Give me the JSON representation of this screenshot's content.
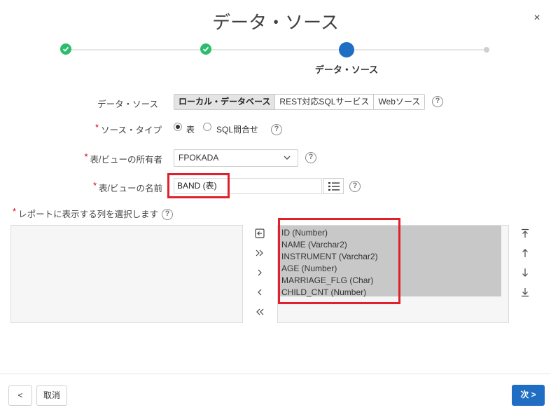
{
  "dialog": {
    "title": "データ・ソース",
    "close": "×"
  },
  "wizard": {
    "current_label": "データ・ソース"
  },
  "form": {
    "data_source_label": "データ・ソース",
    "data_source_options": [
      "ローカル・データベース",
      "REST対応SQLサービス",
      "Webソース"
    ],
    "source_type_label": "ソース・タイプ",
    "source_type_options": [
      "表",
      "SQL問合せ"
    ],
    "owner_label": "表/ビューの所有者",
    "owner_value": "FPOKADA",
    "name_label": "表/ビューの名前",
    "name_value": "BAND (表)",
    "columns_label": "レポートに表示する列を選択します",
    "help": "?",
    "required_mark": "*"
  },
  "shuttle": {
    "selected_columns": [
      "ID (Number)",
      "NAME (Varchar2)",
      "INSTRUMENT (Varchar2)",
      "AGE (Number)",
      "MARRIAGE_FLG (Char)",
      "CHILD_CNT (Number)"
    ]
  },
  "footer": {
    "back": "<",
    "cancel": "取消",
    "next": "次 >"
  },
  "colors": {
    "done": "#2bbd6c",
    "current": "#1f6ec4",
    "highlight": "#e0202a",
    "required": "#d0021b"
  }
}
